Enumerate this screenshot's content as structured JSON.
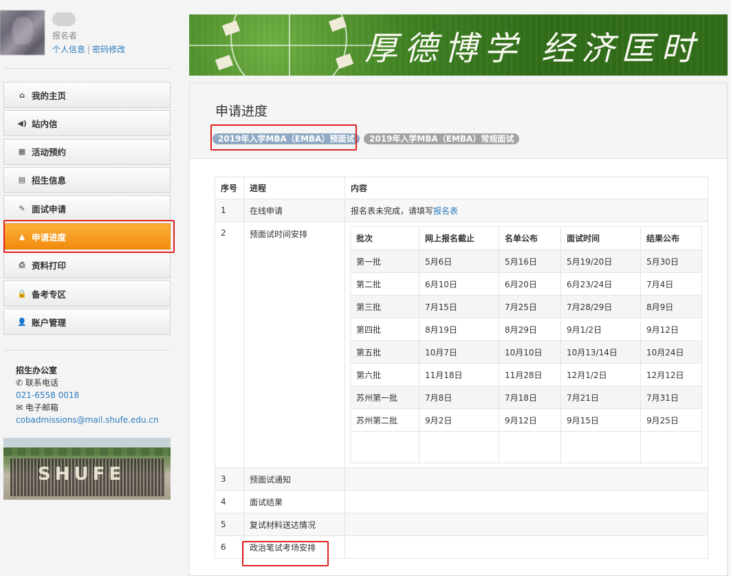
{
  "profile": {
    "role": "报名者",
    "link_info": "个人信息",
    "link_sep": "|",
    "link_password": "密码修改"
  },
  "menu": [
    {
      "label": "我的主页",
      "icon": "home-icon",
      "glyph": "⌂"
    },
    {
      "label": "站内信",
      "icon": "volume-icon",
      "glyph": "◀)"
    },
    {
      "label": "活动预约",
      "icon": "calendar-icon",
      "glyph": "▦"
    },
    {
      "label": "招生信息",
      "icon": "book-icon",
      "glyph": "▤"
    },
    {
      "label": "面试申请",
      "icon": "edit-icon",
      "glyph": "✎"
    },
    {
      "label": "申请进度",
      "icon": "road-icon",
      "glyph": "▲",
      "active": true
    },
    {
      "label": "资料打印",
      "icon": "print-icon",
      "glyph": "⎙"
    },
    {
      "label": "备考专区",
      "icon": "lock-icon",
      "glyph": "🔒"
    },
    {
      "label": "账户管理",
      "icon": "user-icon",
      "glyph": "👤"
    }
  ],
  "contact": {
    "title": "招生办公室",
    "phone_label": "联系电话",
    "phone": "021-6558 0018",
    "email_label": "电子邮箱",
    "email": "cobadmissions@mail.shufe.edu.cn"
  },
  "campus_image_text": "SHUFE",
  "banner_text": "厚德博学 经济匡时",
  "panel": {
    "title": "申请进度",
    "tabs": [
      "2019年入学MBA（EMBA）预面试",
      "2019年入学MBA（EMBA）常规面试"
    ]
  },
  "progress": {
    "headers": [
      "序号",
      "进程",
      "内容"
    ],
    "row1": {
      "no": "1",
      "step": "在线申请",
      "content_prefix": "报名表未完成，请填写",
      "content_link": "报名表"
    },
    "row2": {
      "no": "2",
      "step": "预面试时间安排"
    },
    "rows_after": [
      {
        "no": "3",
        "step": "预面试通知"
      },
      {
        "no": "4",
        "step": "面试结果"
      },
      {
        "no": "5",
        "step": "复试材料送达情况"
      },
      {
        "no": "6",
        "step": "政治笔试考场安排"
      }
    ]
  },
  "schedule": {
    "headers": [
      "批次",
      "网上报名截止",
      "名单公布",
      "面试时间",
      "结果公布"
    ],
    "rows": [
      [
        "第一批",
        "5月6日",
        "5月16日",
        "5月19/20日",
        "5月30日"
      ],
      [
        "第二批",
        "6月10日",
        "6月20日",
        "6月23/24日",
        "7月4日"
      ],
      [
        "第三批",
        "7月15日",
        "7月25日",
        "7月28/29日",
        "8月9日"
      ],
      [
        "第四批",
        "8月19日",
        "8月29日",
        "9月1/2日",
        "9月12日"
      ],
      [
        "第五批",
        "10月7日",
        "10月10日",
        "10月13/14日",
        "10月24日"
      ],
      [
        "第六批",
        "11月18日",
        "11月28日",
        "12月1/2日",
        "12月12日"
      ],
      [
        "苏州第一批",
        "7月8日",
        "7月18日",
        "7月21日",
        "7月31日"
      ],
      [
        "苏州第二批",
        "9月2日",
        "9月12日",
        "9月15日",
        "9月25日"
      ]
    ]
  },
  "colors": {
    "accent": "#f28a0c",
    "link": "#2a7bbf",
    "highlight": "#e02020"
  }
}
